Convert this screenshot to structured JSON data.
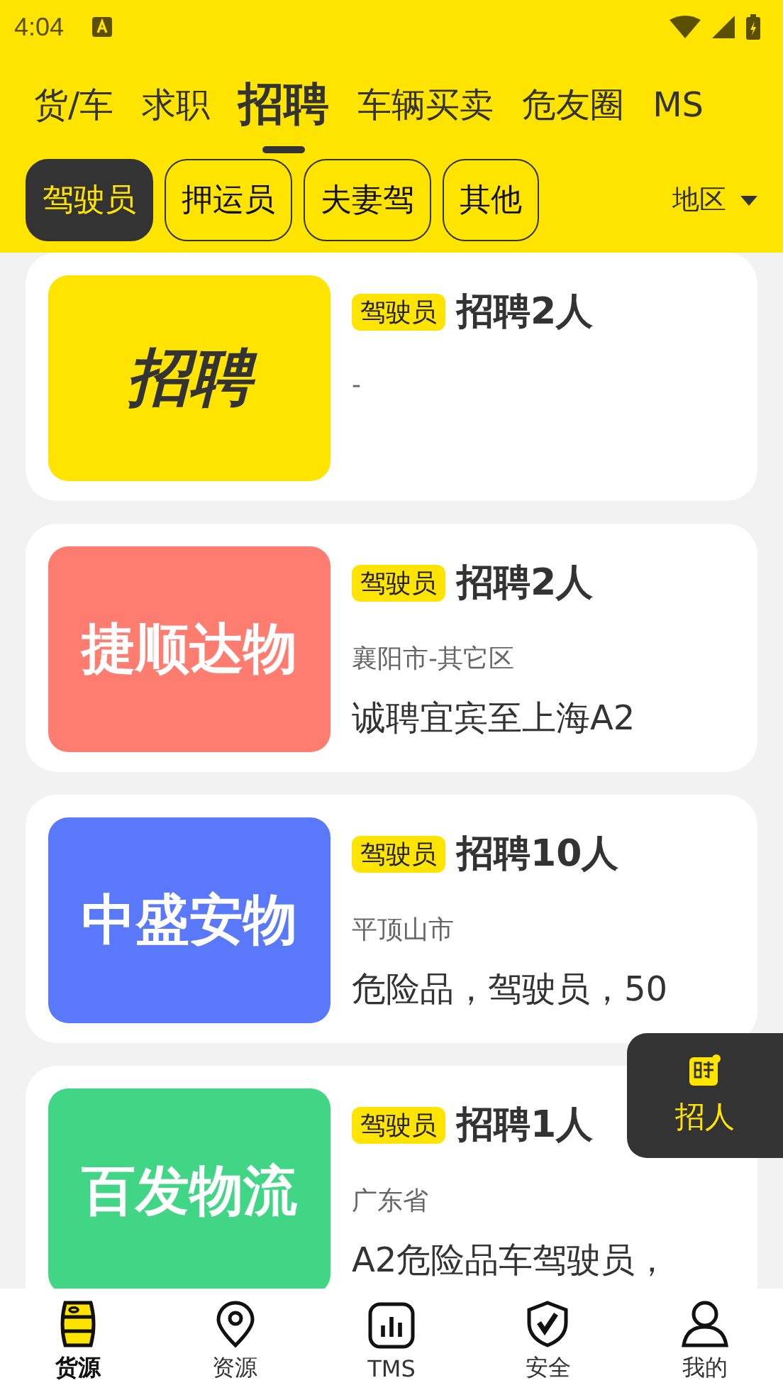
{
  "status_bar": {
    "time": "4:04"
  },
  "top_tabs": [
    {
      "label": "货/车",
      "selected": false
    },
    {
      "label": "求职",
      "selected": false
    },
    {
      "label": "招聘",
      "selected": true
    },
    {
      "label": "车辆买卖",
      "selected": false
    },
    {
      "label": "危友圈",
      "selected": false
    },
    {
      "label": "MS",
      "selected": false
    }
  ],
  "filters": [
    {
      "label": "驾驶员",
      "selected": true
    },
    {
      "label": "押运员",
      "selected": false
    },
    {
      "label": "夫妻驾",
      "selected": false
    },
    {
      "label": "其他",
      "selected": false
    }
  ],
  "region_dropdown": {
    "label": "地区"
  },
  "listings": [
    {
      "kind": "wordmark",
      "logo_text": "招聘",
      "color": "#ffe400",
      "tag": "驾驶员",
      "title": "招聘2人",
      "location": "-"
    },
    {
      "kind": "name",
      "logo_text": "捷顺达物",
      "color": "#ff7c70",
      "tag": "驾驶员",
      "title": "招聘2人",
      "location": "襄阳市-其它区",
      "description": "诚聘宜宾至上海A2"
    },
    {
      "kind": "name",
      "logo_text": "中盛安物",
      "color": "#5a78fa",
      "tag": "驾驶员",
      "title": "招聘10人",
      "location": "平顶山市",
      "description": "危险品，驾驶员，50"
    },
    {
      "kind": "name",
      "logo_text": "百发物流",
      "color": "#40d686",
      "tag": "驾驶员",
      "title": "招聘1人",
      "location": "广东省",
      "description": "A2危险品车驾驶员，"
    }
  ],
  "fab": {
    "label": "招人"
  },
  "bottom_nav": [
    {
      "label": "货源",
      "selected": true
    },
    {
      "label": "资源",
      "selected": false
    },
    {
      "label": "TMS",
      "selected": false
    },
    {
      "label": "安全",
      "selected": false
    },
    {
      "label": "我的",
      "selected": false
    }
  ]
}
